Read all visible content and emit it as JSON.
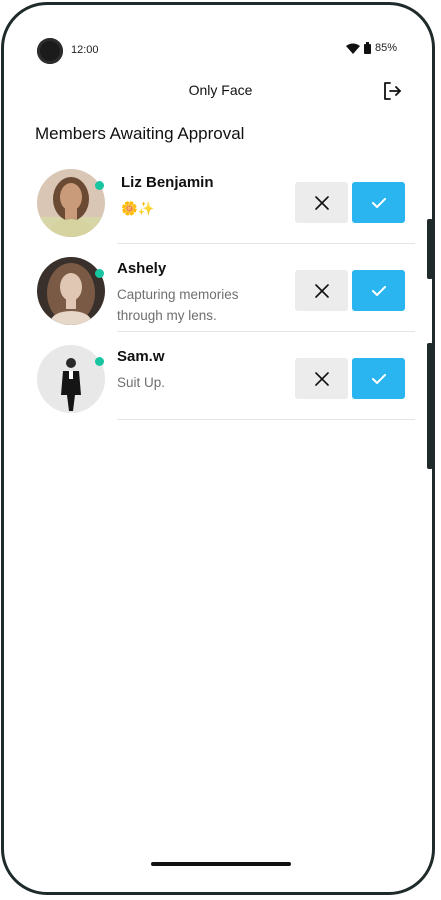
{
  "status_bar": {
    "time": "12:00",
    "battery": "85%"
  },
  "header": {
    "title": "Only Face",
    "logout_icon": "logout-icon"
  },
  "section": {
    "title": "Members Awaiting Approval"
  },
  "members": [
    {
      "name": "Liz Benjamin",
      "bio": "🌼✨",
      "online": true,
      "avatar_colors": [
        "#c99b7a",
        "#6b4a33",
        "#d6d3a0"
      ]
    },
    {
      "name": "Ashely",
      "bio": "Capturing memories through my lens.",
      "online": true,
      "avatar_colors": [
        "#2a211d",
        "#7a5a45",
        "#e0c7b3"
      ]
    },
    {
      "name": "Sam.w",
      "bio": "Suit Up.",
      "online": true,
      "avatar_colors": [
        "#e6e6e6",
        "#1a1a1a",
        "#cccccc"
      ]
    }
  ],
  "actions": {
    "reject_icon": "close-icon",
    "approve_icon": "check-icon"
  },
  "colors": {
    "approve": "#2bb5f0",
    "reject_bg": "#ececec",
    "online": "#19c4a0"
  }
}
